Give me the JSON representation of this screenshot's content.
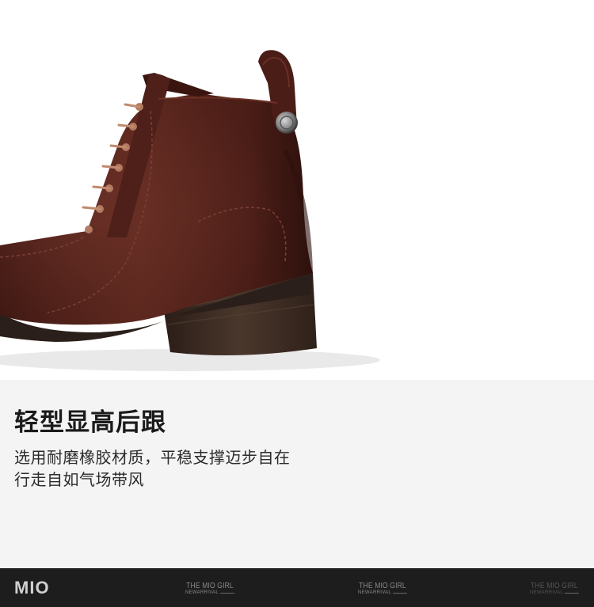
{
  "headline": "轻型显高后跟",
  "description": {
    "line1": "选用耐磨橡胶材质，平稳支撑迈步自在",
    "line2": "行走自如气场带风"
  },
  "footer": {
    "brand": "MIO",
    "tags": [
      {
        "title": "THE MIO GIRL",
        "subtitle": "NEWARRIVAL"
      },
      {
        "title": "THE MIO GIRL",
        "subtitle": "NEWARRIVAL"
      },
      {
        "title": "THE MIO GIRL",
        "subtitle": "NEWARRIVAL"
      }
    ]
  },
  "colors": {
    "leather": "#4a1d17",
    "heel": "#3b2a22",
    "background": "#f4f4f4",
    "footer": "#1d1d1d"
  }
}
